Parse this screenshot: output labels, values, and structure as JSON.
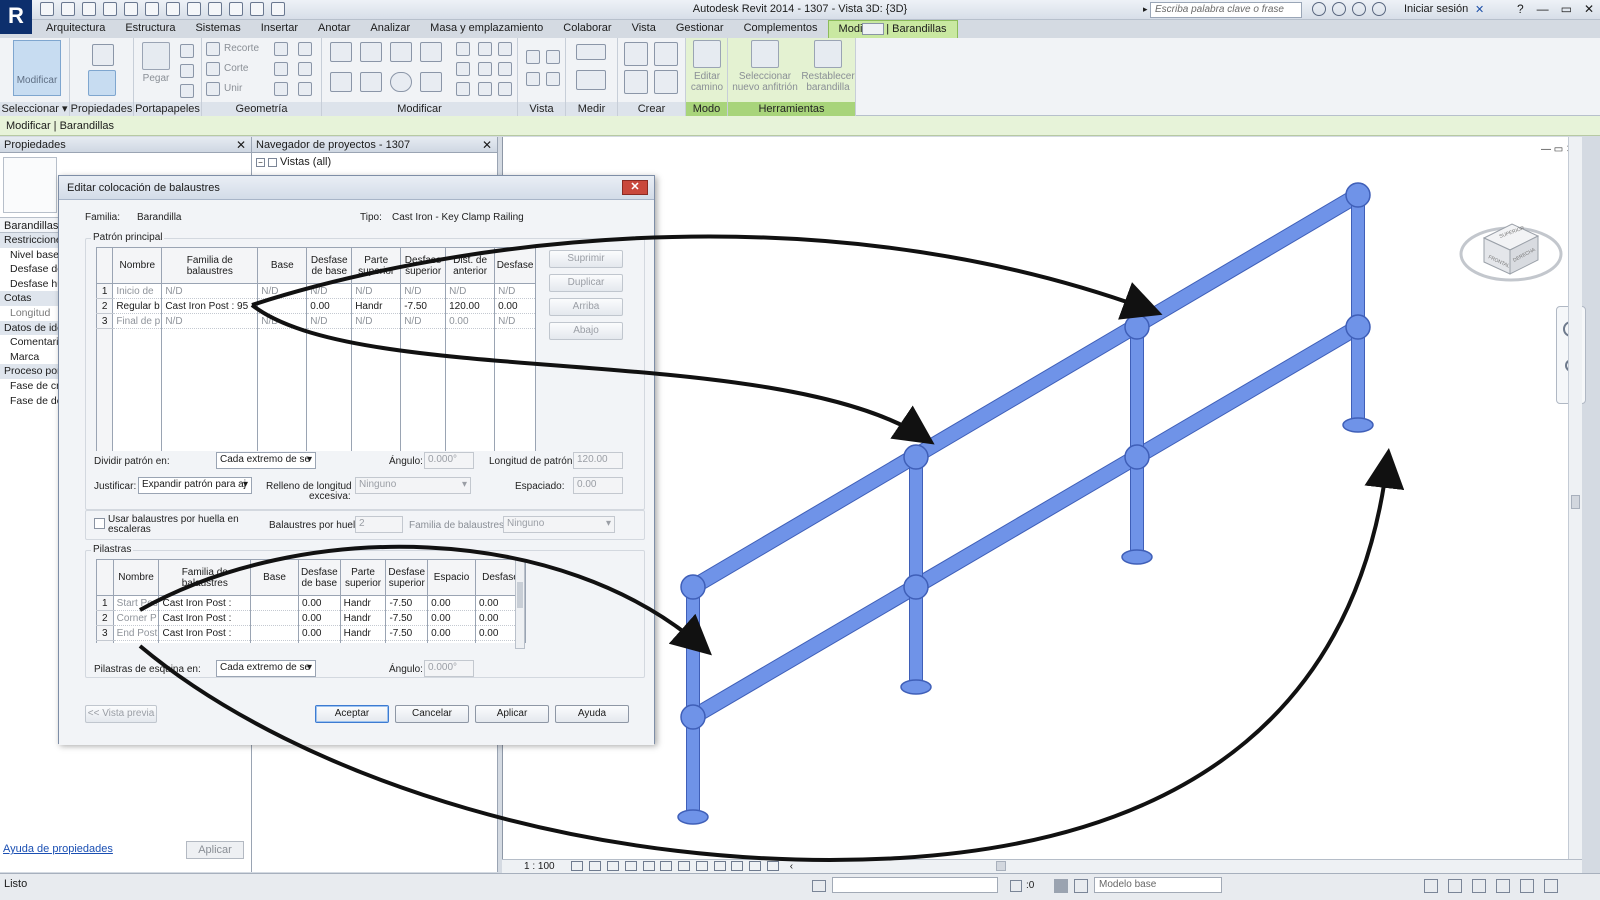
{
  "app": {
    "title": "Autodesk Revit 2014 -     1307 - Vista 3D: {3D}",
    "search_placeholder": "Escriba palabra clave o frase",
    "signin": "Iniciar sesión",
    "logo": "R"
  },
  "ribbon": {
    "tabs": [
      "Arquitectura",
      "Estructura",
      "Sistemas",
      "Insertar",
      "Anotar",
      "Analizar",
      "Masa y emplazamiento",
      "Colaborar",
      "Vista",
      "Gestionar",
      "Complementos",
      "Modificar | Barandillas"
    ],
    "panels": {
      "seleccionar": "Seleccionar ▾",
      "propiedades": "Propiedades",
      "portapapeles": "Portapapeles",
      "geometria": "Geometría",
      "modificar": "Modificar",
      "vista": "Vista",
      "medir": "Medir",
      "crear": "Crear",
      "modo": "Modo",
      "herramientas": "Herramientas"
    },
    "buttons": {
      "modificar": "Modificar",
      "pegar": "Pegar",
      "recorte": "Recorte",
      "corte": "Corte",
      "unir": "Unir",
      "editar_camino_1": "Editar",
      "editar_camino_2": "camino",
      "seleccionar_anfitrion_1": "Seleccionar",
      "seleccionar_anfitrion_2": "nuevo anfitrión",
      "restablecer_1": "Restablecer",
      "restablecer_2": "barandilla"
    }
  },
  "context_bar": "Modificar | Barandillas",
  "properties": {
    "title": "Propiedades",
    "type": "Barandillas (",
    "rows": [
      {
        "t": "Restriccione",
        "cat": true
      },
      {
        "t": "Nivel base"
      },
      {
        "t": "Desfase de"
      },
      {
        "t": "Desfase hu"
      },
      {
        "t": "Cotas",
        "cat": true
      },
      {
        "t": "Longitud",
        "dim": true
      },
      {
        "t": "Datos de ide",
        "cat": true
      },
      {
        "t": "Comentari"
      },
      {
        "t": "Marca"
      },
      {
        "t": "Proceso por",
        "cat": true
      },
      {
        "t": "Fase de cre"
      },
      {
        "t": "Fase de der"
      }
    ],
    "help_link": "Ayuda de propiedades",
    "apply": "Aplicar"
  },
  "project_browser": {
    "title": "Navegador de proyectos - 1307",
    "root": "Vistas (all)"
  },
  "dialog": {
    "title": "Editar colocación de balaustres",
    "familia_label": "Familia:",
    "familia_value": "Barandilla",
    "tipo_label": "Tipo:",
    "tipo_value": "Cast Iron - Key Clamp Railing",
    "main_pattern": {
      "label": "Patrón principal",
      "headers": [
        "",
        "Nombre",
        "Familia de balaustres",
        "Base",
        "Desfase de base",
        "Parte superior",
        "Desfase superior",
        "Dist. de anterior",
        "Desfase"
      ],
      "rows": [
        {
          "n": "1",
          "cells": [
            "Inicio de",
            "N/D",
            "N/D",
            "N/D",
            "N/D",
            "N/D",
            "N/D",
            "N/D"
          ],
          "dim": true
        },
        {
          "n": "2",
          "cells": [
            "Regular b",
            "Cast Iron Post : 95",
            "",
            "0.00",
            "Handr",
            "-7.50",
            "120.00",
            "0.00"
          ],
          "dim": false
        },
        {
          "n": "3",
          "cells": [
            "Final de p",
            "N/D",
            "N/D",
            "N/D",
            "N/D",
            "N/D",
            "0.00",
            "N/D"
          ],
          "dim": true
        }
      ],
      "side_buttons": [
        "Suprimir",
        "Duplicar",
        "Arriba",
        "Abajo"
      ]
    },
    "break_label": "Dividir patrón en:",
    "break_value": "Cada extremo de se",
    "angle_label": "Ángulo:",
    "angle_value": "0.000°",
    "pattern_length_label": "Longitud de patrón:",
    "pattern_length_value": "120.00",
    "justify_label": "Justificar:",
    "justify_value": "Expandir patrón para aj",
    "excess_label_1": "Relleno de longitud",
    "excess_label_2": "excesiva:",
    "excess_value": "Ninguno",
    "spacing_label": "Espaciado:",
    "spacing_value": "0.00",
    "stairs_check_1": "Usar balaustres por huella en",
    "stairs_check_2": "escaleras",
    "per_tread_label": "Balaustres por huella:",
    "per_tread_value": "2",
    "baluster_family_label": "Familia de balaustres:",
    "baluster_family_value": "Ninguno",
    "posts": {
      "label": "Pilastras",
      "headers": [
        "",
        "Nombre",
        "Familia de balaustres",
        "Base",
        "Desfase de base",
        "Parte superior",
        "Desfase superior",
        "Espacio",
        "Desfase"
      ],
      "rows": [
        {
          "n": "1",
          "cells": [
            "Start Post",
            "Cast Iron Post :",
            "",
            "0.00",
            "Handr",
            "-7.50",
            "0.00",
            "0.00"
          ]
        },
        {
          "n": "2",
          "cells": [
            "Corner P",
            "Cast Iron Post :",
            "",
            "0.00",
            "Handr",
            "-7.50",
            "0.00",
            "0.00"
          ]
        },
        {
          "n": "3",
          "cells": [
            "End Post",
            "Cast Iron Post :",
            "",
            "0.00",
            "Handr",
            "-7.50",
            "0.00",
            "0.00"
          ]
        }
      ]
    },
    "corner_label": "Pilastras de esquina en:",
    "corner_value": "Cada extremo de se",
    "corner_angle_label": "Ángulo:",
    "corner_angle_value": "0.000°",
    "buttons": {
      "preview": "<< Vista previa",
      "ok": "Aceptar",
      "cancel": "Cancelar",
      "apply": "Aplicar",
      "help": "Ayuda"
    }
  },
  "viewport": {
    "scale": "1 : 100",
    "viewcube_faces": [
      "SUPERIOR",
      "FRONTAL",
      "DERECHA"
    ],
    "railing_color": "#6f93e8",
    "railing_edge": "#3f5fb8"
  },
  "status": {
    "text": "Listo",
    "count": ":0",
    "model": "Modelo base"
  }
}
